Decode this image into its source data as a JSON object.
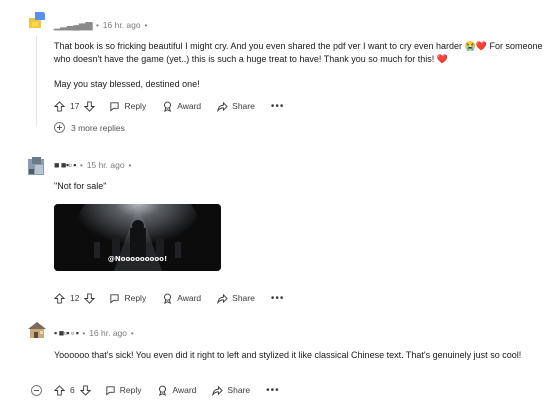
{
  "comments": [
    {
      "username": "▁▂▃▄▅▆",
      "time": "16 hr. ago",
      "body": [
        "That book is so fricking beautiful I might cry. And you even shared the pdf ver I want to cry even harder 😭❤️ For someone who doesn't have the game (yet..) this is such a huge treat to have! Thank you so much for this! ❤️",
        "May you stay blessed, destined one!"
      ],
      "votes": "17",
      "more_replies": "3 more replies"
    },
    {
      "username": "■  ■▪▫    ▪",
      "time": "15 hr. ago",
      "body": [
        "\"Not for sale\""
      ],
      "gif_caption": "@Nooooooooo!",
      "votes": "12"
    },
    {
      "username": "▪ ■▫▪ ▫ ▪",
      "time": "16 hr. ago",
      "body": [
        "Yoooooo that's sick! You even did it right to left and stylized it like classical Chinese text. That's genuinely just so cool!"
      ],
      "votes": "6"
    }
  ],
  "actions": {
    "reply": "Reply",
    "award": "Award",
    "share": "Share",
    "more": "•••"
  },
  "separator": "•",
  "icons": [
    "upvote-icon",
    "downvote-icon",
    "reply-icon",
    "award-icon",
    "share-icon",
    "more-icon",
    "expand-icon",
    "collapse-icon"
  ]
}
